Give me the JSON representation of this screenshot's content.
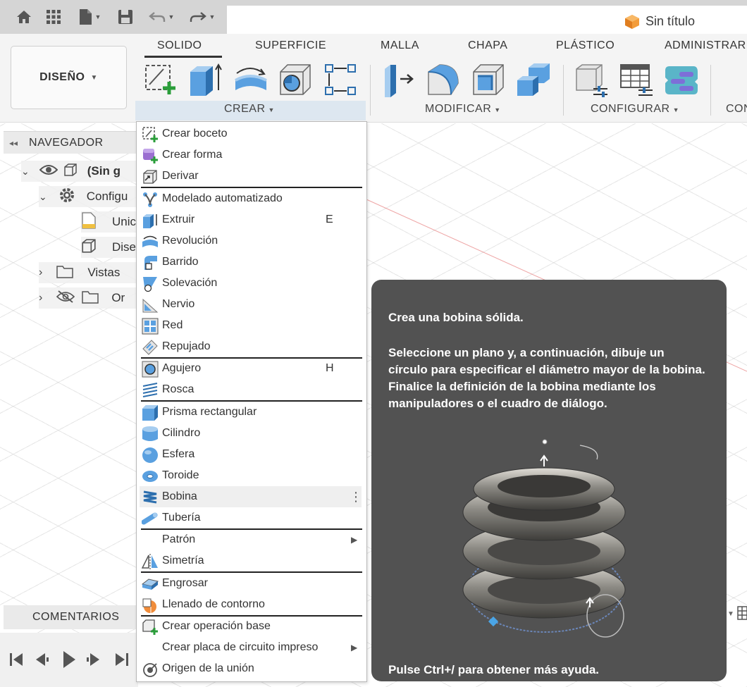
{
  "document": {
    "title": "Sin título"
  },
  "quick_toolbar": {
    "icons": [
      "home-icon",
      "grid-icon",
      "file-icon",
      "save-icon",
      "undo-icon",
      "redo-icon"
    ]
  },
  "workspace": {
    "label": "DISEÑO"
  },
  "tabs": [
    {
      "label": "SOLIDO",
      "active": true
    },
    {
      "label": "SUPERFICIE"
    },
    {
      "label": "MALLA"
    },
    {
      "label": "CHAPA"
    },
    {
      "label": "PLÁSTICO"
    },
    {
      "label": "ADMINISTRAR"
    }
  ],
  "groups": {
    "crear": "CREAR",
    "modificar": "MODIFICAR",
    "configurar": "CONFIGURAR",
    "construir": "CONS"
  },
  "navigator": {
    "title": "NAVEGADOR",
    "items": [
      {
        "label": "(Sin g"
      },
      {
        "label": "Configu"
      },
      {
        "label": "Unic"
      },
      {
        "label": "Dise"
      },
      {
        "label": "Vistas"
      },
      {
        "label": "Or"
      }
    ]
  },
  "comments": {
    "label": "COMENTARIOS"
  },
  "menu": {
    "items": [
      {
        "label": "Crear boceto"
      },
      {
        "label": "Crear forma"
      },
      {
        "label": "Derivar"
      },
      {
        "label": "Modelado automatizado"
      },
      {
        "label": "Extruir",
        "shortcut": "E"
      },
      {
        "label": "Revolución"
      },
      {
        "label": "Barrido"
      },
      {
        "label": "Solevación"
      },
      {
        "label": "Nervio"
      },
      {
        "label": "Red"
      },
      {
        "label": "Repujado"
      },
      {
        "label": "Agujero",
        "shortcut": "H"
      },
      {
        "label": "Rosca"
      },
      {
        "label": "Prisma rectangular"
      },
      {
        "label": "Cilindro"
      },
      {
        "label": "Esfera"
      },
      {
        "label": "Toroide"
      },
      {
        "label": "Bobina"
      },
      {
        "label": "Tubería"
      },
      {
        "label": "Patrón"
      },
      {
        "label": "Simetría"
      },
      {
        "label": "Engrosar"
      },
      {
        "label": "Llenado de contorno"
      },
      {
        "label": "Crear operación base"
      },
      {
        "label": "Crear placa de circuito impreso"
      },
      {
        "label": "Origen de la unión"
      }
    ]
  },
  "tooltip": {
    "title": "Crea una bobina sólida.",
    "body": "Seleccione un plano y, a continuación, dibuje un círculo para especificar el diámetro mayor de la bobina. Finalice la definición de la bobina mediante los manipuladores o el cuadro de diálogo.",
    "help": "Pulse Ctrl+/ para obtener más ayuda."
  },
  "colors": {
    "accent": "#4a90d9",
    "tooltip_bg": "#525252",
    "menu_hover": "#efefef"
  }
}
